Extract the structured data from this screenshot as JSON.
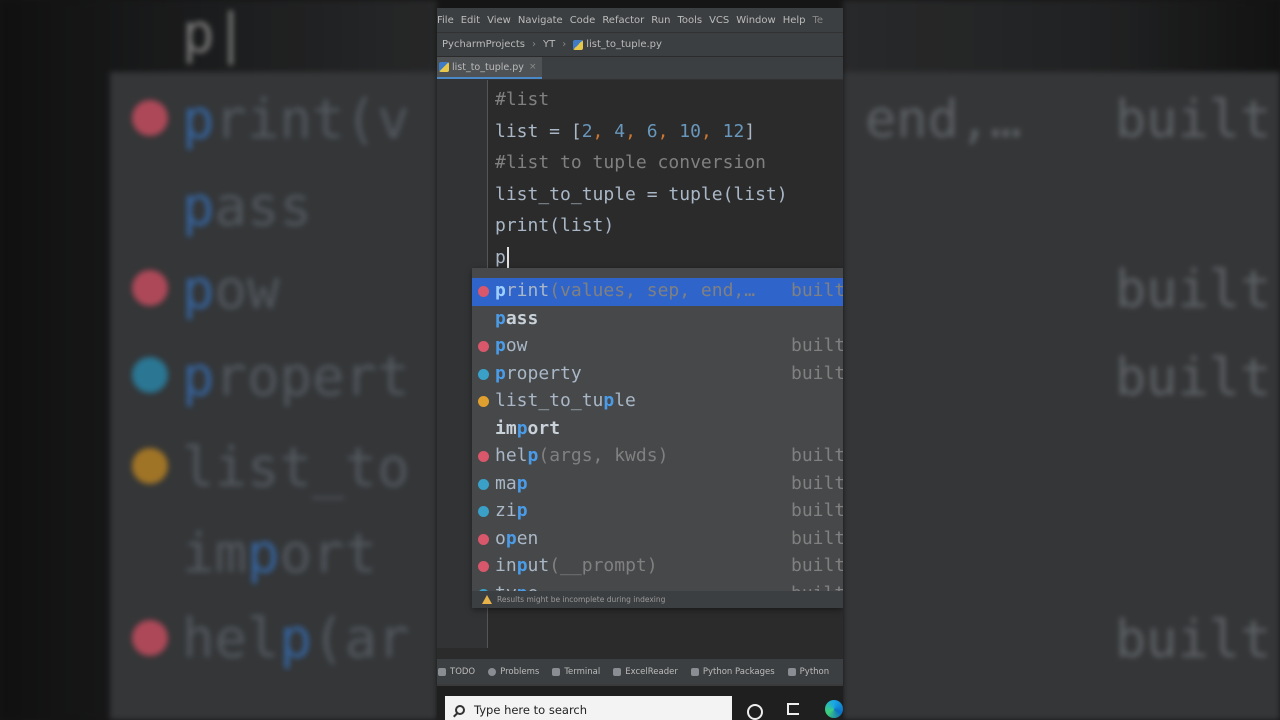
{
  "menu": [
    "File",
    "Edit",
    "View",
    "Navigate",
    "Code",
    "Refactor",
    "Run",
    "Tools",
    "VCS",
    "Window",
    "Help",
    "Te"
  ],
  "breadcrumb": {
    "project": "PycharmProjects",
    "folder": "YT",
    "file": "list_to_tuple.py"
  },
  "tab": {
    "label": "list_to_tuple.py",
    "close": "×"
  },
  "editor": {
    "line1": "#list",
    "line2_prefix": "list = [",
    "line2_values": [
      "2",
      "4",
      "6",
      "10",
      "12"
    ],
    "line2_suffix": "]",
    "line3": "#list to tuple conversion",
    "line4": "list_to_tuple = tuple(list)",
    "line5": "print(list)",
    "line6": "p"
  },
  "completion": {
    "items": [
      {
        "pre": "",
        "match": "p",
        "post": "rint",
        "args": "(values, sep, end,…",
        "type": "built",
        "icon": "method-icon",
        "color": "#d8576b",
        "selected": true
      },
      {
        "pre": "",
        "match": "p",
        "post": "ass",
        "args": "",
        "type": "",
        "icon": "",
        "color": "",
        "selected": false,
        "keyword": true
      },
      {
        "pre": "",
        "match": "p",
        "post": "ow",
        "args": "",
        "type": "built",
        "icon": "method-icon",
        "color": "#d8576b"
      },
      {
        "pre": "",
        "match": "p",
        "post": "roperty",
        "args": "",
        "type": "built",
        "icon": "class-icon",
        "color": "#3aa0c8"
      },
      {
        "pre": "list_to_tu",
        "match": "p",
        "post": "le",
        "args": "",
        "type": "",
        "icon": "variable-icon",
        "color": "#e0a030"
      },
      {
        "pre": "im",
        "match": "p",
        "post": "ort",
        "args": "",
        "type": "",
        "icon": "",
        "color": "",
        "keyword": true
      },
      {
        "pre": "hel",
        "match": "p",
        "post": "",
        "args": "(args, kwds)",
        "type": "built",
        "icon": "method-icon",
        "color": "#d8576b"
      },
      {
        "pre": "ma",
        "match": "p",
        "post": "",
        "args": "",
        "type": "built",
        "icon": "class-icon",
        "color": "#3aa0c8"
      },
      {
        "pre": "zi",
        "match": "p",
        "post": "",
        "args": "",
        "type": "built",
        "icon": "class-icon",
        "color": "#3aa0c8"
      },
      {
        "pre": "o",
        "match": "p",
        "post": "en",
        "args": "",
        "type": "built",
        "icon": "method-icon",
        "color": "#d8576b"
      },
      {
        "pre": "in",
        "match": "p",
        "post": "ut",
        "args": "(__prompt)",
        "type": "built",
        "icon": "method-icon",
        "color": "#d8576b"
      },
      {
        "pre": "ty",
        "match": "p",
        "post": "e",
        "args": "",
        "type": "built",
        "icon": "class-icon",
        "color": "#3aa0c8"
      }
    ],
    "footer": "Results might be incomplete during indexing"
  },
  "toolwindows": [
    "TODO",
    "Problems",
    "Terminal",
    "ExcelReader",
    "Python Packages",
    "Python"
  ],
  "taskbar": {
    "search_placeholder": "Type here to search"
  }
}
